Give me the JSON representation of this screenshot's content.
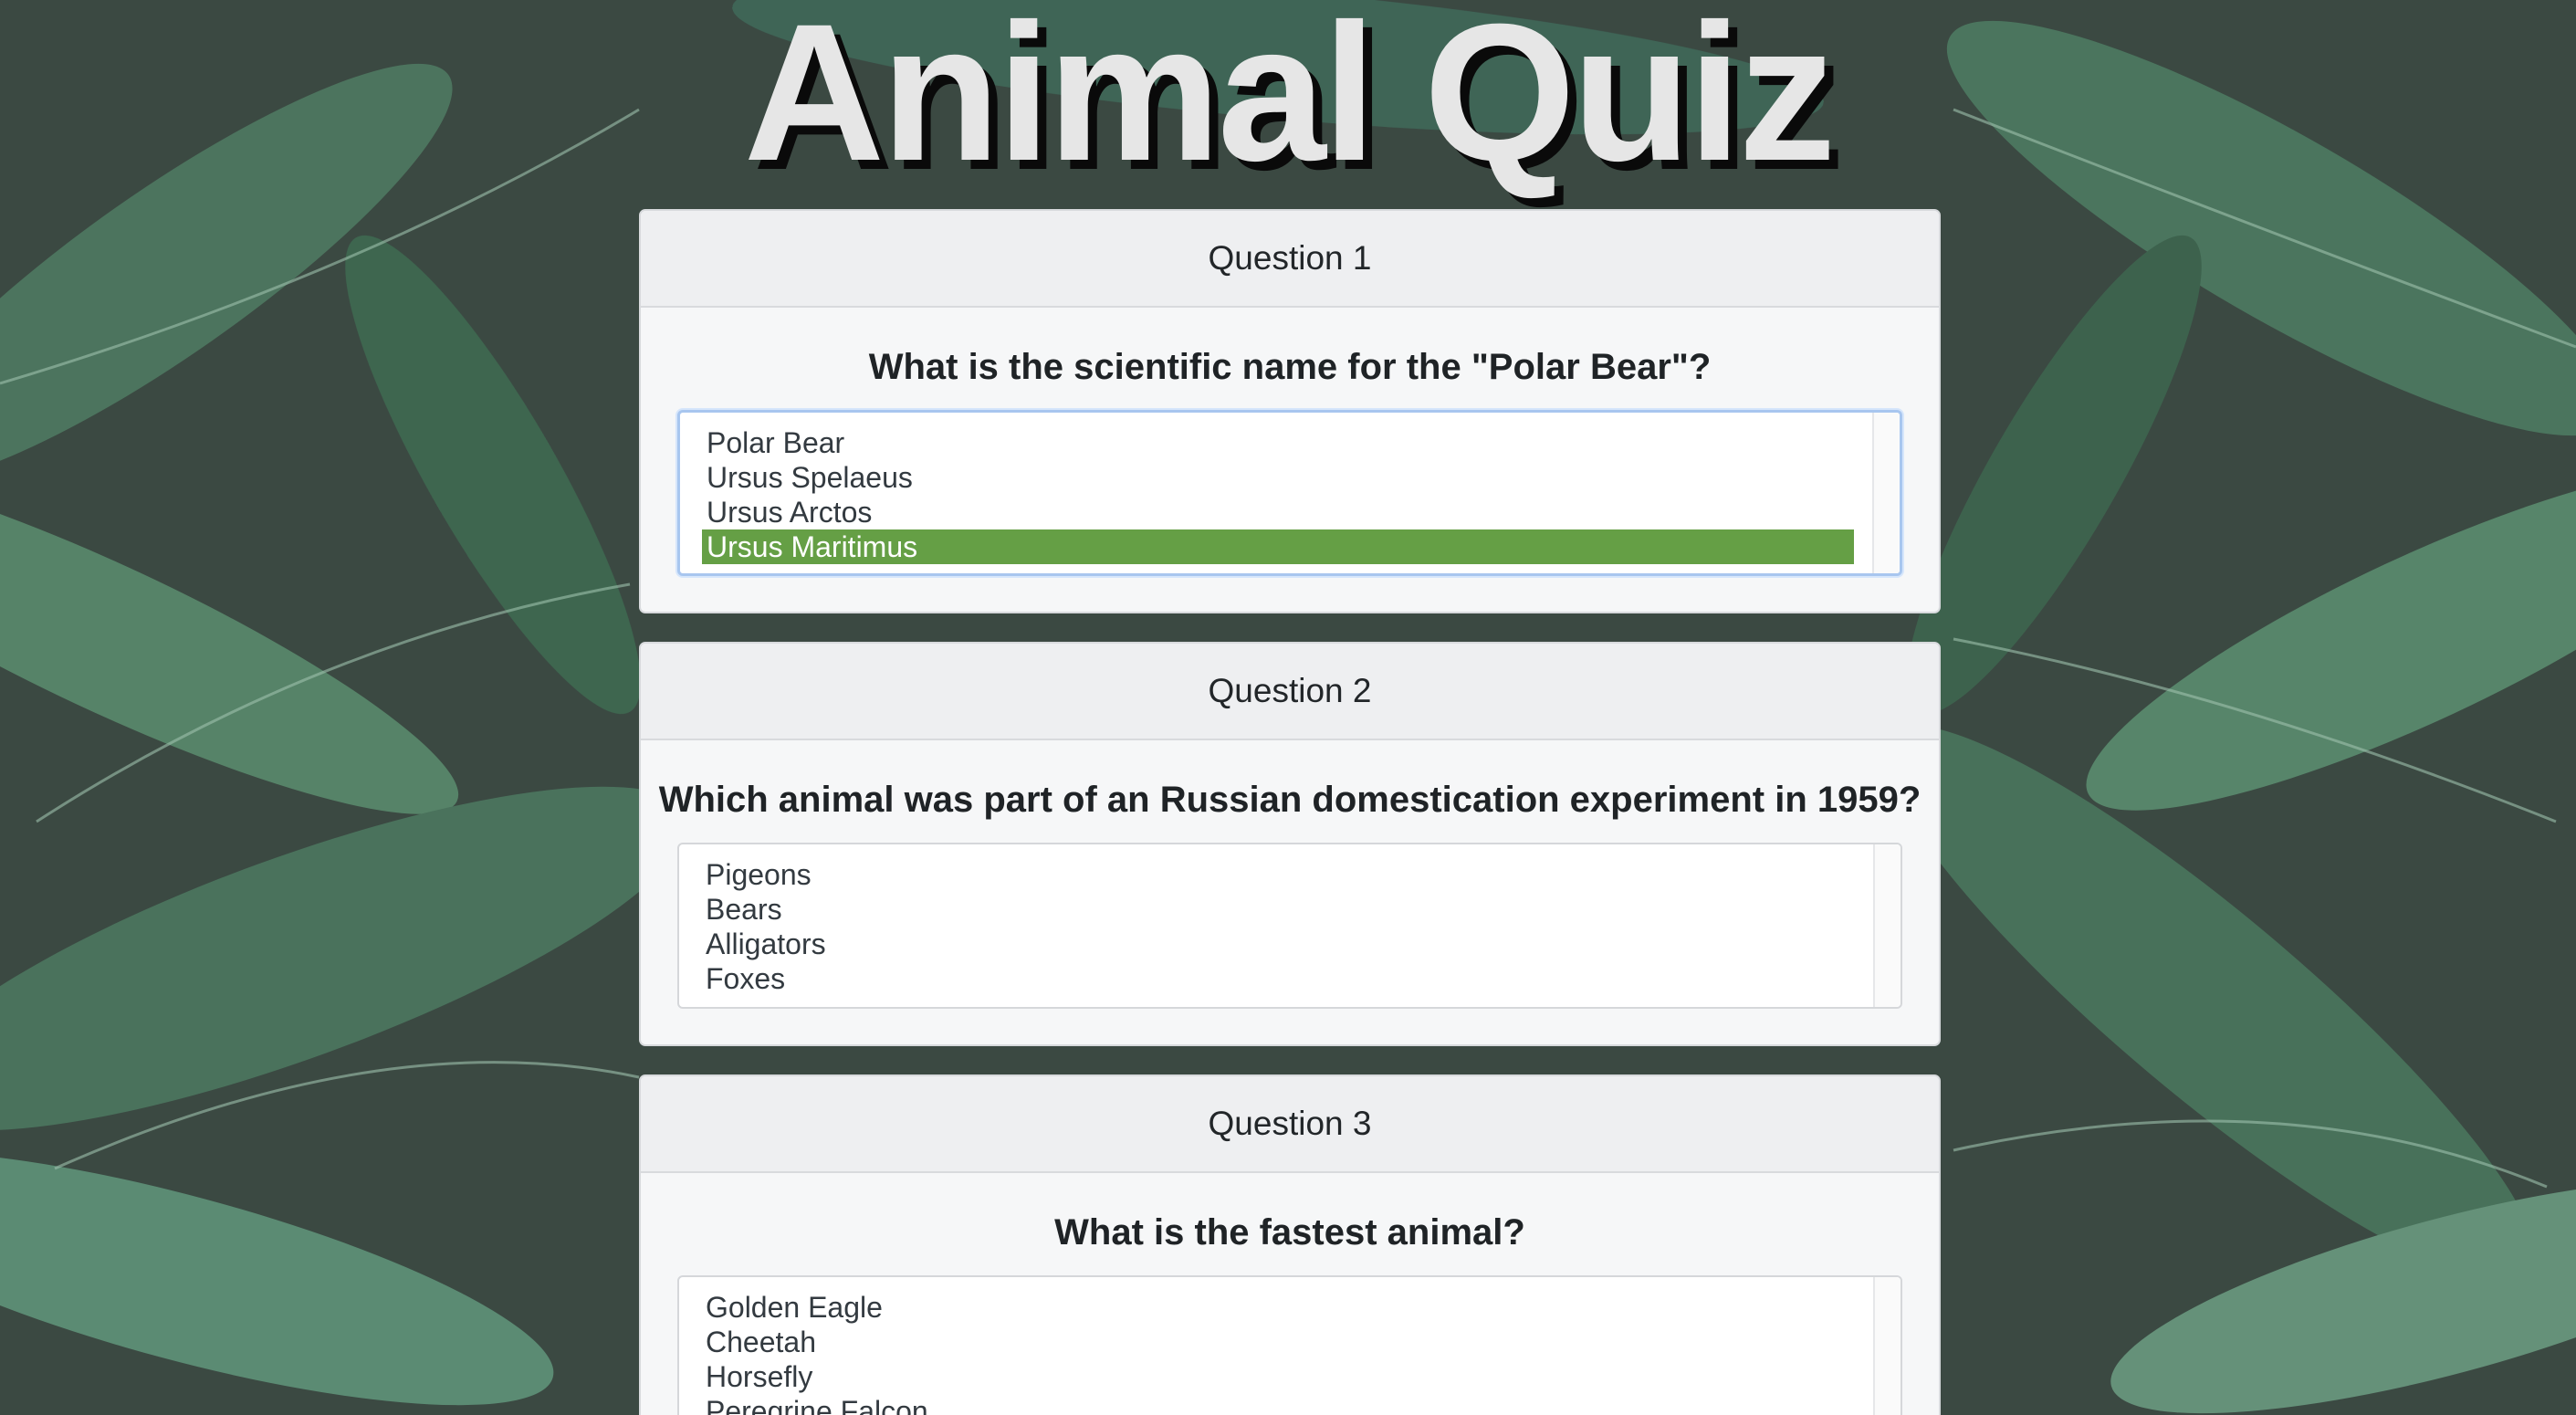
{
  "page": {
    "title": "Animal Quiz"
  },
  "colors": {
    "selected_option": "#659f45",
    "card_background": "#f6f7f8",
    "title_text": "#e6e6e6",
    "title_shadow": "#0a0a0a"
  },
  "questions": [
    {
      "header": "Question 1",
      "text": "What is the scientific name for the \"Polar Bear\"?",
      "options": [
        "Polar Bear",
        "Ursus Spelaeus",
        "Ursus Arctos",
        "Ursus Maritimus"
      ],
      "selected": "Ursus Maritimus"
    },
    {
      "header": "Question 2",
      "text": "Which animal was part of an Russian domestication experiment in 1959?",
      "options": [
        "Pigeons",
        "Bears",
        "Alligators",
        "Foxes"
      ],
      "selected": null
    },
    {
      "header": "Question 3",
      "text": "What is the fastest animal?",
      "options": [
        "Golden Eagle",
        "Cheetah",
        "Horsefly",
        "Peregrine Falcon"
      ],
      "selected": null
    }
  ]
}
